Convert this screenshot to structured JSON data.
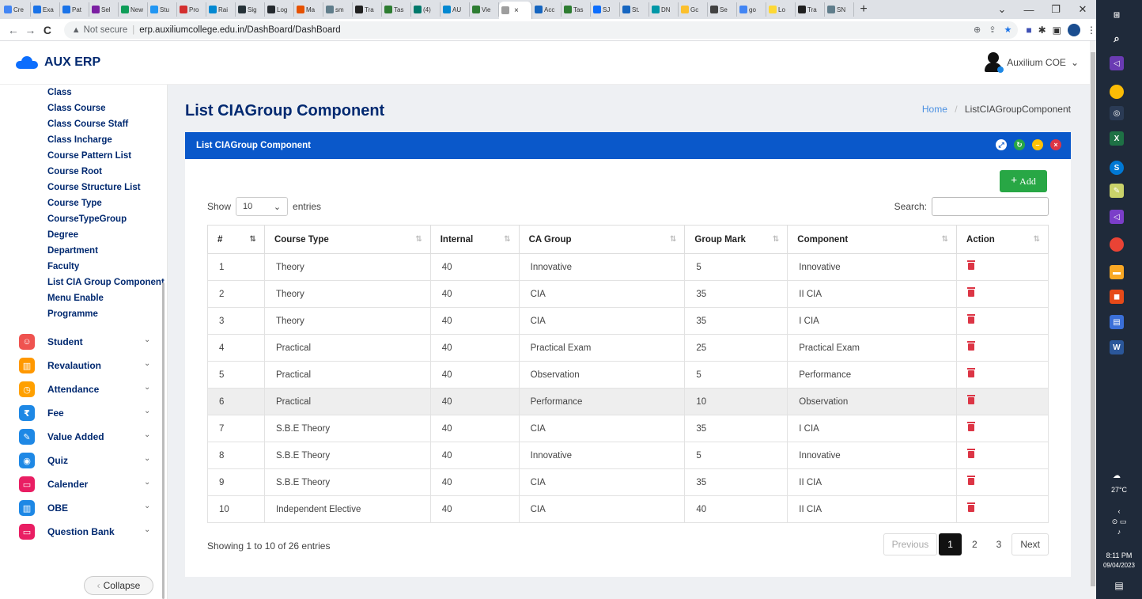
{
  "browser": {
    "tabs": [
      {
        "label": "Cre",
        "color": "#4285f4"
      },
      {
        "label": "Exa",
        "color": "#1a73e8"
      },
      {
        "label": "Pat",
        "color": "#1a73e8"
      },
      {
        "label": "Sel",
        "color": "#7b1fa2"
      },
      {
        "label": "New",
        "color": "#0f9d58"
      },
      {
        "label": "Stu",
        "color": "#2196f3"
      },
      {
        "label": "Pro",
        "color": "#d32f2f"
      },
      {
        "label": "Rai",
        "color": "#0288d1"
      },
      {
        "label": "Sig",
        "color": "#263238"
      },
      {
        "label": "Log",
        "color": "#24292e"
      },
      {
        "label": "Ma",
        "color": "#e65100"
      },
      {
        "label": "sm",
        "color": "#607d8b"
      },
      {
        "label": "Tra",
        "color": "#212121"
      },
      {
        "label": "Tas",
        "color": "#2e7d32"
      },
      {
        "label": "(4)",
        "color": "#00796b"
      },
      {
        "label": "AU",
        "color": "#0288d1"
      },
      {
        "label": "Vie",
        "color": "#2e7d32"
      },
      {
        "label": "",
        "color": "#9e9e9e",
        "active": true
      },
      {
        "label": "Acc",
        "color": "#1565c0"
      },
      {
        "label": "Tas",
        "color": "#2e7d32"
      },
      {
        "label": "SJ",
        "color": "#0d6efd"
      },
      {
        "label": "St.",
        "color": "#1565c0"
      },
      {
        "label": "DN",
        "color": "#0097a7"
      },
      {
        "label": "Gc",
        "color": "#fbc02d"
      },
      {
        "label": "Se",
        "color": "#424242"
      },
      {
        "label": "go",
        "color": "#4285f4"
      },
      {
        "label": "Lo",
        "color": "#fdd835"
      },
      {
        "label": "Tra",
        "color": "#212121"
      },
      {
        "label": "SN",
        "color": "#607d8b"
      }
    ],
    "tab_close": "×",
    "new_tab": "+",
    "window_controls": [
      "⌄",
      "—",
      "❐",
      "✕"
    ],
    "nav": {
      "back": "←",
      "forward": "→",
      "reload": "C"
    },
    "omnibox": {
      "warning_icon": "▲",
      "security_label": "Not secure",
      "url": "erp.auxiliumcollege.edu.in/DashBoard/DashBoard"
    }
  },
  "app": {
    "brand": "AUX ERP",
    "user_name": "Auxilium COE",
    "user_chevron": "⌄"
  },
  "sidebar": {
    "subitems": [
      "Class",
      "Class Course",
      "Class Course Staff",
      "Class Incharge",
      "Course Pattern List",
      "Course Root",
      "Course Structure List",
      "Course Type",
      "CourseTypeGroup",
      "Degree",
      "Department",
      "Faculty",
      "List CIA Group Component",
      "Menu Enable",
      "Programme"
    ],
    "menu": [
      {
        "label": "Student",
        "icon": "student-icon",
        "color": "#ef5350",
        "glyph": "☺"
      },
      {
        "label": "Revalaution",
        "icon": "book-icon",
        "color": "#ff9800",
        "glyph": "▥"
      },
      {
        "label": "Attendance",
        "icon": "clock-icon",
        "color": "#ffa000",
        "glyph": "◷"
      },
      {
        "label": "Fee",
        "icon": "rupee-icon",
        "color": "#1e88e5",
        "glyph": "₹"
      },
      {
        "label": "Value Added",
        "icon": "edit-icon",
        "color": "#1e88e5",
        "glyph": "✎"
      },
      {
        "label": "Quiz",
        "icon": "target-icon",
        "color": "#1e88e5",
        "glyph": "◉"
      },
      {
        "label": "Calender",
        "icon": "calendar-icon",
        "color": "#e91e63",
        "glyph": "▭"
      },
      {
        "label": "OBE",
        "icon": "book-open-icon",
        "color": "#1e88e5",
        "glyph": "▥"
      },
      {
        "label": "Question Bank",
        "icon": "calendar-icon",
        "color": "#e91e63",
        "glyph": "▭"
      }
    ],
    "collapse_label": "Collapse",
    "collapse_arrow": "‹"
  },
  "main": {
    "page_title": "List CIAGroup Component",
    "breadcrumb": {
      "home": "Home",
      "separator": "/",
      "current": "ListCIAGroupComponent"
    },
    "card_title": "List CIAGroup Component",
    "card_controls": [
      {
        "name": "expand",
        "color": "#ffffff",
        "glyph": "⤢",
        "fg": "#0a58ca"
      },
      {
        "name": "refresh",
        "color": "#28a745",
        "glyph": "↻",
        "fg": "#fff"
      },
      {
        "name": "minimize",
        "color": "#ffc107",
        "glyph": "–",
        "fg": "#fff"
      },
      {
        "name": "close",
        "color": "#dc3545",
        "glyph": "×",
        "fg": "#fff"
      }
    ],
    "add_label": "Add",
    "add_glyph": "+",
    "show_label": "Show",
    "entries_value": "10",
    "entries_label": "entries",
    "search_label": "Search:",
    "table": {
      "columns": [
        "#",
        "Course Type",
        "Internal",
        "CA Group",
        "Group Mark",
        "Component",
        "Action"
      ],
      "rows": [
        [
          "1",
          "Theory",
          "40",
          "Innovative",
          "5",
          "Innovative"
        ],
        [
          "2",
          "Theory",
          "40",
          "CIA",
          "35",
          "II CIA"
        ],
        [
          "3",
          "Theory",
          "40",
          "CIA",
          "35",
          "I CIA"
        ],
        [
          "4",
          "Practical",
          "40",
          "Practical Exam",
          "25",
          "Practical Exam"
        ],
        [
          "5",
          "Practical",
          "40",
          "Observation",
          "5",
          "Performance"
        ],
        [
          "6",
          "Practical",
          "40",
          "Performance",
          "10",
          "Observation"
        ],
        [
          "7",
          "S.B.E Theory",
          "40",
          "CIA",
          "35",
          "I CIA"
        ],
        [
          "8",
          "S.B.E Theory",
          "40",
          "Innovative",
          "5",
          "Innovative"
        ],
        [
          "9",
          "S.B.E Theory",
          "40",
          "CIA",
          "35",
          "II CIA"
        ],
        [
          "10",
          "Independent Elective",
          "40",
          "CIA",
          "40",
          "II CIA"
        ]
      ],
      "highlighted_row": 5
    },
    "info": "Showing 1 to 10 of 26 entries",
    "pager": {
      "prev": "Previous",
      "pages": [
        "1",
        "2",
        "3"
      ],
      "current": "1",
      "next": "Next"
    }
  },
  "taskbar": {
    "temperature": "27°C",
    "time": "8:11 PM",
    "date": "09/04/2023"
  }
}
